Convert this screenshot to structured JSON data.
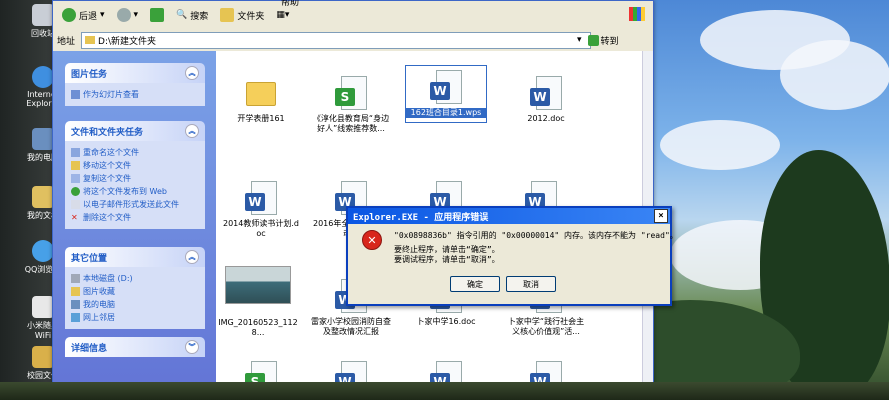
{
  "desktop": {
    "icons": [
      {
        "label": "回收站"
      },
      {
        "label": "Internet Explorer"
      },
      {
        "label": "我的电脑"
      },
      {
        "label": "我的文档"
      },
      {
        "label": "QQ浏览器"
      },
      {
        "label": "小米随身WiFi"
      },
      {
        "label": "校园文件"
      }
    ]
  },
  "toolbar": {
    "back_label": "后退",
    "search_label": "搜索",
    "folders_label": "文件夹",
    "help_label": "帮助"
  },
  "address": {
    "label": "地址",
    "path": "D:\\新建文件夹",
    "go_label": "转到"
  },
  "left_pane": {
    "picture_tasks": {
      "title": "图片任务",
      "items": [
        "作为幻灯片查看"
      ]
    },
    "file_tasks": {
      "title": "文件和文件夹任务",
      "items": [
        "重命名这个文件",
        "移动这个文件",
        "复制这个文件",
        "将这个文件发布到 Web",
        "以电子邮件形式发送此文件",
        "删除这个文件"
      ]
    },
    "other_places": {
      "title": "其它位置",
      "items": [
        "本地磁盘 (D:)",
        "图片收藏",
        "我的电脑",
        "网上邻居"
      ]
    },
    "details": {
      "title": "详细信息"
    }
  },
  "files": [
    {
      "name": "开学表册161",
      "type": "folder"
    },
    {
      "name": "《淳化县教育局“身边好人”线索推荐数...",
      "type": "sheet"
    },
    {
      "name": "162班合目录1.wps",
      "type": "word",
      "selected": true
    },
    {
      "name": "2012.doc",
      "type": "word"
    },
    {
      "name": "2014教师读书计划.doc",
      "type": "word"
    },
    {
      "name": "2016年全县...家访活动...",
      "type": "word"
    },
    {
      "name": "",
      "type": "word"
    },
    {
      "name": "",
      "type": "word"
    },
    {
      "name": "IMG_20160523_1128...",
      "type": "image"
    },
    {
      "name": "雷家小学校园消防自查及整改情况汇报",
      "type": "word"
    },
    {
      "name": "卜家中学16.doc",
      "type": "word"
    },
    {
      "name": "卜家中学“践行社会主义核心价值观”活...",
      "type": "word"
    },
    {
      "name": "",
      "type": "sheet"
    },
    {
      "name": "",
      "type": "word"
    },
    {
      "name": "",
      "type": "word"
    },
    {
      "name": "",
      "type": "word"
    }
  ],
  "dialog": {
    "title": "Explorer.EXE - 应用程序错误",
    "close": "×",
    "line1": "\"0x0898836b\" 指令引用的 \"0x00000014\" 内存。该内存不能为 \"read\"。",
    "line2": "要终止程序，请单击“确定”。",
    "line3": "要调试程序，请单击“取消”。",
    "ok_label": "确定",
    "cancel_label": "取消"
  },
  "icons": {
    "back": "back-arrow-icon",
    "error": "error-icon",
    "folder": "folder-icon",
    "word": "word-doc-icon",
    "sheet": "spreadsheet-icon"
  },
  "colors": {
    "xp_blue": "#0a56e3",
    "task_panel": "#d6dff7",
    "selection": "#316ac5",
    "error_red": "#d8261c"
  }
}
